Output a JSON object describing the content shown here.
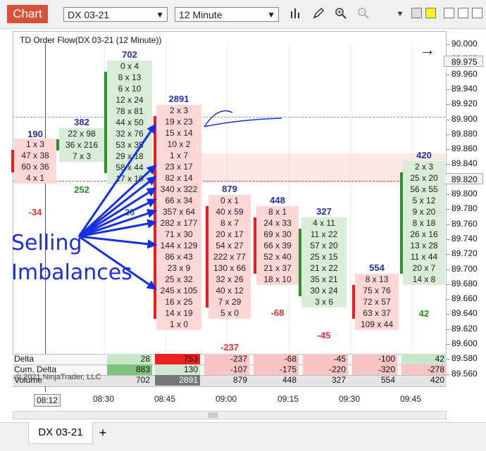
{
  "toolbar": {
    "chart_button": "Chart",
    "instrument": "DX 03-21",
    "interval": "12 Minute"
  },
  "chart": {
    "title": "TD Order Flow(DX 03-21 (12 Minute))",
    "last_price": "89.975",
    "current_price": "89.820",
    "copyright": "© 2021 NinjaTrader, LLC",
    "y_labels": [
      "90.000",
      "89.980",
      "89.960",
      "89.940",
      "89.920",
      "89.900",
      "89.880",
      "89.860",
      "89.840",
      "89.820",
      "89.800",
      "89.780",
      "89.760",
      "89.740",
      "89.720",
      "89.700",
      "89.680",
      "89.660",
      "89.640",
      "89.620",
      "89.600",
      "89.580",
      "89.560"
    ],
    "x_labels": [
      "08:12",
      "08:30",
      "08:45",
      "09:00",
      "09:15",
      "09:30",
      "09:45"
    ]
  },
  "bars": [
    {
      "volume": "190",
      "delta": "-34",
      "cells": [
        "1 x 3",
        "47 x 38",
        "60 x 36",
        "4 x 1"
      ]
    },
    {
      "volume": "382",
      "delta": "252",
      "cells": [
        "22 x 98",
        "36 x 216",
        "7 x 3"
      ]
    },
    {
      "volume": "702",
      "delta": "26",
      "cells": [
        "0 x 4",
        "8 x 13",
        "6 x 10",
        "12 x 24",
        "78 x 81",
        "44 x 50",
        "32 x 76",
        "53 x 35",
        "29 x 18",
        "58 x 44",
        "17 x 10"
      ]
    },
    {
      "volume": "2891",
      "delta": "",
      "cells": [
        "2 x 3",
        "19 x 23",
        "15 x 14",
        "10 x 2",
        "1 x 7",
        "23 x 17",
        "82 x 14",
        "340 x 322",
        "66 x 34",
        "357 x 64",
        "282 x 177",
        "71 x 30",
        "144 x 129",
        "86 x 43",
        "23 x 9",
        "25 x 32",
        "245 x 105",
        "16 x 25",
        "14 x 19",
        "1 x 0"
      ]
    },
    {
      "volume": "879",
      "delta": "-237",
      "cells": [
        "0 x 1",
        "40 x 59",
        "8 x 7",
        "20 x 17",
        "54 x 27",
        "222 x 77",
        "130 x 66",
        "32 x 26",
        "40 x 12",
        "7 x 29",
        "5 x 0"
      ]
    },
    {
      "volume": "448",
      "delta": "-68",
      "cells": [
        "8 x 1",
        "24 x 33",
        "69 x 30",
        "66 x 39",
        "52 x 40",
        "21 x 37",
        "18 x 10"
      ]
    },
    {
      "volume": "327",
      "delta": "-45",
      "cells": [
        "4 x 11",
        "11 x 22",
        "57 x 20",
        "25 x 15",
        "21 x 22",
        "35 x 21",
        "30 x 24",
        "3 x 6"
      ]
    },
    {
      "volume": "554",
      "delta": "",
      "cells": [
        "8 x 13",
        "75 x 76",
        "72 x 57",
        "63 x 37",
        "109 x 44"
      ]
    },
    {
      "volume": "420",
      "delta": "42",
      "cells": [
        "2 x 3",
        "25 x 20",
        "56 x 55",
        "5 x 12",
        "9 x 20",
        "8 x 18",
        "26 x 16",
        "13 x 28",
        "11 x 44",
        "20 x 7",
        "14 x 8"
      ]
    }
  ],
  "table": {
    "labels": [
      "Delta",
      "Cum. Delta",
      "Volume"
    ],
    "delta": [
      "28",
      "753",
      "-237",
      "-68",
      "-45",
      "-100",
      "42"
    ],
    "cum_delta": [
      "883",
      "130",
      "-107",
      "-175",
      "-220",
      "-320",
      "-278"
    ],
    "volume": [
      "702",
      "2891",
      "879",
      "448",
      "327",
      "554",
      "420"
    ]
  },
  "annotation": {
    "line1": "Selling",
    "line2": "Imbalances"
  },
  "tabs": {
    "active": "DX 03-21",
    "add": "+"
  }
}
